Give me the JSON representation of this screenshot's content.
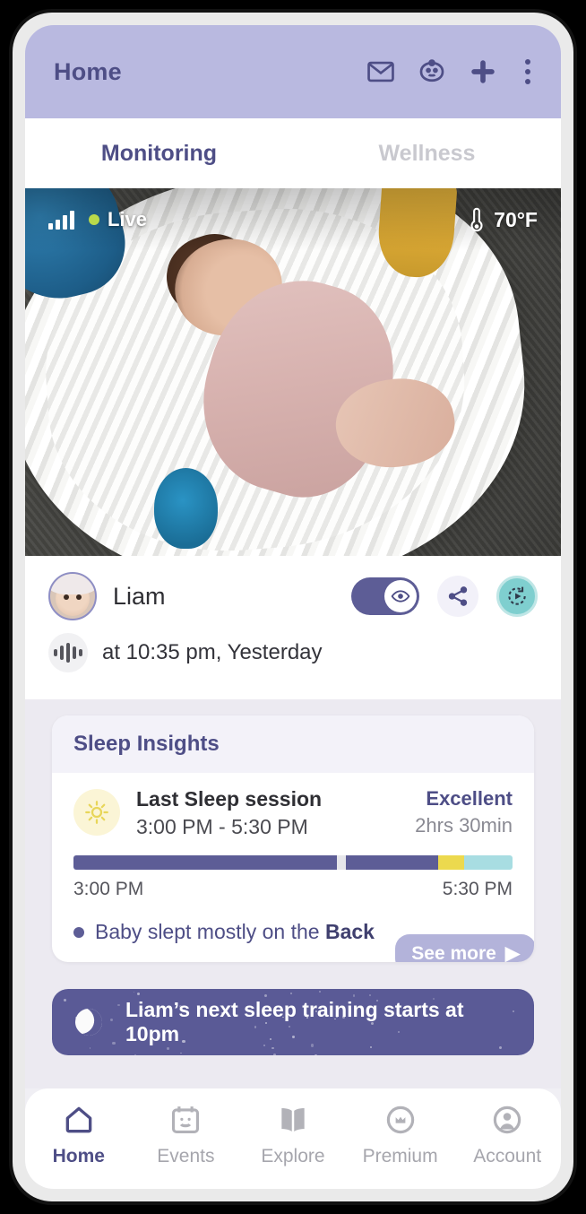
{
  "header": {
    "title": "Home",
    "icons": [
      "mail-icon",
      "baby-face-icon",
      "plus-icon",
      "more-vertical-icon"
    ]
  },
  "tabs": [
    {
      "label": "Monitoring",
      "active": true
    },
    {
      "label": "Wellness",
      "active": false
    }
  ],
  "video": {
    "signal_icon": "signal-bars-icon",
    "live_label": "Live",
    "live_dot_color": "#b9d94a",
    "thermometer_icon": "thermometer-icon",
    "temperature": "70°F"
  },
  "child": {
    "name": "Liam",
    "avatar": "baby-avatar",
    "toggle_on": true,
    "toggle_icon": "eye-icon",
    "share_icon": "share-icon",
    "replay_icon": "replay-icon",
    "timestamp_icon": "audio-wave-icon",
    "timestamp": "at 10:35 pm, Yesterday"
  },
  "sleep_insights": {
    "title": "Sleep Insights",
    "session_icon": "sun-icon",
    "session_label": "Last Sleep session",
    "session_range": "3:00 PM - 5:30 PM",
    "quality": "Excellent",
    "duration": "2hrs 30min",
    "start_label": "3:00 PM",
    "end_label": "5:30 PM",
    "note_prefix": "Baby slept mostly on the ",
    "note_highlight": "Back",
    "see_more_label": "See more",
    "see_more_arrow": "▶",
    "timeline": {
      "segments": [
        {
          "name": "deep-sleep",
          "pct": 60.0,
          "color": "#5d5d96"
        },
        {
          "name": "awake-gap",
          "pct": 2.0,
          "color": "#e6e6ea"
        },
        {
          "name": "deep-sleep",
          "pct": 21.0,
          "color": "#5d5d96"
        },
        {
          "name": "light-sleep",
          "pct": 6.0,
          "color": "#ecd94e"
        },
        {
          "name": "restless",
          "pct": 11.0,
          "color": "#a8dde2"
        }
      ]
    }
  },
  "banner": {
    "icon": "moon-icon",
    "text": "Liam’s next sleep training starts at 10pm"
  },
  "bottom_nav": [
    {
      "label": "Home",
      "icon": "home-icon",
      "active": true
    },
    {
      "label": "Events",
      "icon": "calendar-icon",
      "active": false
    },
    {
      "label": "Explore",
      "icon": "book-icon",
      "active": false
    },
    {
      "label": "Premium",
      "icon": "crown-badge-icon",
      "active": false
    },
    {
      "label": "Account",
      "icon": "person-icon",
      "active": false
    }
  ],
  "colors": {
    "brand_purple": "#4e4e86",
    "header_bg": "#b9b9e0",
    "accent_teal": "#7fcfcf",
    "accent_yellow": "#ecd94e",
    "inactive_gray": "#a6a6ad"
  }
}
